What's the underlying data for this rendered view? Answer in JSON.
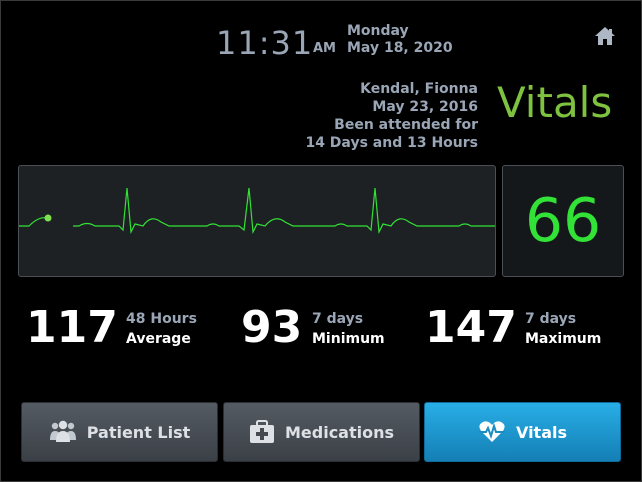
{
  "header": {
    "time": "11:31",
    "ampm": "AM",
    "weekday": "Monday",
    "date": "May 18, 2020"
  },
  "patient": {
    "name": "Kendal, Fionna",
    "date": "May 23, 2016",
    "attended_line1": "Been attended for",
    "attended_line2": "14 Days and 13 Hours"
  },
  "screen_title": "Vitals",
  "heart_rate": "66",
  "stats": [
    {
      "value": "117",
      "period": "48 Hours",
      "label": "Average"
    },
    {
      "value": "93",
      "period": "7 days",
      "label": "Minimum"
    },
    {
      "value": "147",
      "period": "7 days",
      "label": "Maximum"
    }
  ],
  "nav": [
    {
      "label": "Patient List",
      "icon": "users-icon",
      "active": false
    },
    {
      "label": "Medications",
      "icon": "medkit-icon",
      "active": false
    },
    {
      "label": "Vitals",
      "icon": "heartbeat-icon",
      "active": true
    }
  ],
  "colors": {
    "accent_green": "#7ec240",
    "ecg_green": "#32e236",
    "active_blue": "#1c9bd3",
    "muted_text": "#9aa6b6"
  }
}
